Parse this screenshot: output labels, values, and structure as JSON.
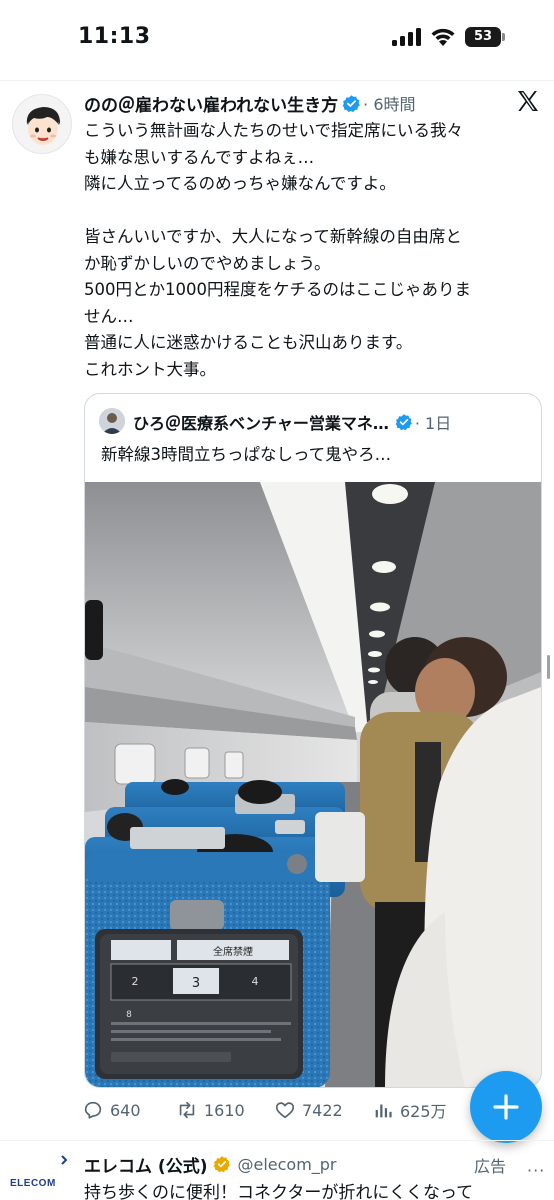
{
  "status_bar": {
    "time": "11:13",
    "battery": "53",
    "icons": [
      "signal-icon",
      "wifi-icon",
      "battery-icon"
    ]
  },
  "tweet": {
    "author_name": "のの＠雇わない雇われない生き方",
    "time_ago": "· 6時間",
    "text": "こういう無計画な人たちのせいで指定席にいる我々\nも嫌な思いするんですよねぇ…\n隣に人立ってるのめっちゃ嫌なんですよ。\n\n皆さんいいですか、大人になって新幹線の自由席と\nか恥ずかしいのでやめましょう。\n500円とか1000円程度をケチるのはここじゃありま\nせん…\n普通に人に迷惑かけることも沢山あります。\nこれホント大事。",
    "icons": [
      "avatar",
      "verified-icon",
      "x-logo-icon"
    ]
  },
  "quote": {
    "author_name": "ひろ＠医療系ベンチャー営業マネ…",
    "time_ago": "· 1日",
    "text": "新幹線3時間立ちっぱなしって鬼やろ…"
  },
  "photo_text": {
    "seat_card_title": "全席禁煙",
    "car_3": "3",
    "car_2": "2",
    "car_4": "4",
    "car_8": "8"
  },
  "actions": {
    "replies": "640",
    "retweets": "1610",
    "likes": "7422",
    "views": "625万"
  },
  "ad": {
    "logo_text": "ELECOM",
    "name": "エレコム (公式)",
    "handle": "@elecom_pr",
    "label": "広告",
    "more": "···",
    "text": "持ち歩くのに便利！コネクターが折れにくくなって"
  },
  "colors": {
    "accent": "#1d9bf0",
    "secondary_text": "#536471",
    "border": "#cfd9de",
    "seat_blue": "#1f6fb3",
    "ad_badge": "#e8a900"
  }
}
